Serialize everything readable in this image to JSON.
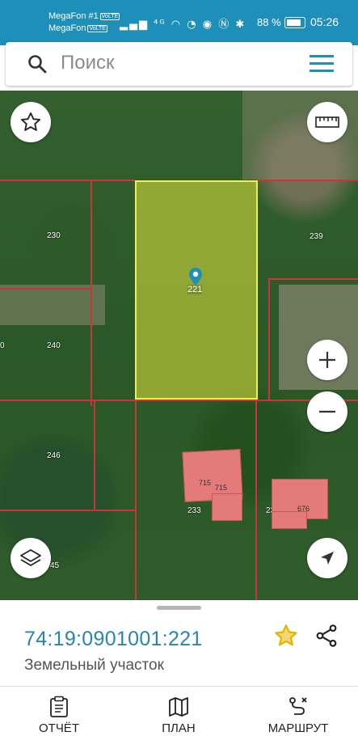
{
  "status_bar": {
    "carrier1": "MegaFon #1",
    "carrier2": "MegaFon",
    "volte": "VoLTE",
    "battery": "88 %",
    "time": "05:26"
  },
  "search": {
    "placeholder": "Поиск"
  },
  "map": {
    "parcel_labels": [
      "230",
      "239",
      "240",
      "246",
      "233",
      "234",
      "45",
      "0"
    ],
    "selected_parcel_label": "221",
    "building_labels": [
      "715",
      "715",
      "676"
    ],
    "selected_color": "#e2e63e",
    "border_color": "#c8353a"
  },
  "details": {
    "cadastral_number": "74:19:0901001:221",
    "object_type": "Земельный участок"
  },
  "tabs": [
    {
      "label": "ОТЧЁТ",
      "icon": "clipboard-icon"
    },
    {
      "label": "ПЛАН",
      "icon": "map-icon"
    },
    {
      "label": "МАРШРУТ",
      "icon": "route-icon"
    }
  ],
  "colors": {
    "accent": "#1e8fb8",
    "link": "#2a84ad",
    "favorite": "#e0b400"
  }
}
